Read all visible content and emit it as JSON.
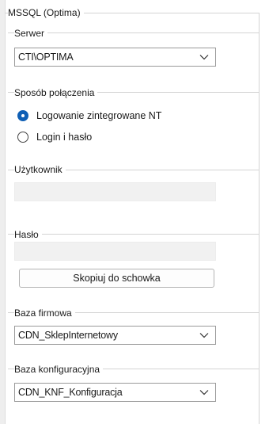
{
  "connection_group": {
    "title": "MSSQL (Optima)"
  },
  "server": {
    "label": "Serwer",
    "value": "CTI\\OPTIMA"
  },
  "connection_mode": {
    "label": "Sposób połączenia",
    "options": [
      {
        "label": "Logowanie zintegrowane NT",
        "selected": true
      },
      {
        "label": "Login i hasło",
        "selected": false
      }
    ]
  },
  "user": {
    "label": "Użytkownik",
    "value": ""
  },
  "password": {
    "label": "Hasło",
    "value": "",
    "copy_button": "Skopiuj do schowka"
  },
  "company_db": {
    "label": "Baza firmowa",
    "value": "CDN_SklepInternetowy"
  },
  "config_db": {
    "label": "Baza konfiguracyjna",
    "value": "CDN_KNF_Konfiguracja"
  },
  "colors": {
    "accent": "#0f5fb5",
    "border": "#d4d4d4",
    "disabled_field": "#f1f1f1"
  }
}
